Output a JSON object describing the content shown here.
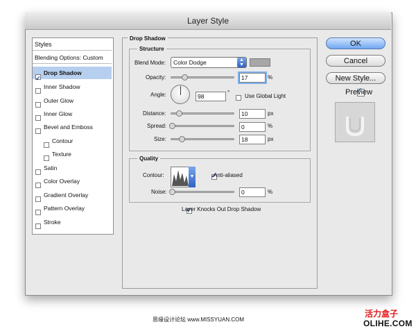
{
  "window": {
    "title": "Layer Style"
  },
  "styles": {
    "header": "Styles",
    "blending_options": "Blending Options: Custom",
    "items": [
      {
        "label": "Drop Shadow",
        "checked": true,
        "selected": true
      },
      {
        "label": "Inner Shadow",
        "checked": false
      },
      {
        "label": "Outer Glow",
        "checked": false
      },
      {
        "label": "Inner Glow",
        "checked": false
      },
      {
        "label": "Bevel and Emboss",
        "checked": false
      },
      {
        "label": "Contour",
        "checked": false,
        "indent": true
      },
      {
        "label": "Texture",
        "checked": false,
        "indent": true
      },
      {
        "label": "Satin",
        "checked": false
      },
      {
        "label": "Color Overlay",
        "checked": false
      },
      {
        "label": "Gradient Overlay",
        "checked": false
      },
      {
        "label": "Pattern Overlay",
        "checked": false
      },
      {
        "label": "Stroke",
        "checked": false
      }
    ]
  },
  "drop_shadow": {
    "section_title": "Drop Shadow",
    "structure": {
      "title": "Structure",
      "blend_mode_label": "Blend Mode:",
      "blend_mode_value": "Color Dodge",
      "swatch_color": "#a7a7a7",
      "opacity_label": "Opacity:",
      "opacity_value": "17",
      "opacity_unit": "%",
      "angle_label": "Angle:",
      "angle_value": "98",
      "angle_unit": "°",
      "use_global_light_label": "Use Global Light",
      "distance_label": "Distance:",
      "distance_value": "10",
      "distance_unit": "px",
      "spread_label": "Spread:",
      "spread_value": "0",
      "spread_unit": "%",
      "size_label": "Size:",
      "size_value": "18",
      "size_unit": "px"
    },
    "quality": {
      "title": "Quality",
      "contour_label": "Contour:",
      "anti_aliased_label": "Anti-aliased",
      "anti_aliased_checked": true,
      "noise_label": "Noise:",
      "noise_value": "0",
      "noise_unit": "%"
    },
    "layer_knocks_label": "Layer Knocks Out Drop Shadow",
    "layer_knocks_checked": true
  },
  "buttons": {
    "ok": "OK",
    "cancel": "Cancel",
    "new_style": "New Style...",
    "preview_label": "Preview",
    "preview_checked": true
  },
  "footer": {
    "text": "思缘设计论坛 www.MISSYUAN.COM",
    "watermark_cn": "活力盒子",
    "watermark_en": "OLIHE.COM"
  }
}
